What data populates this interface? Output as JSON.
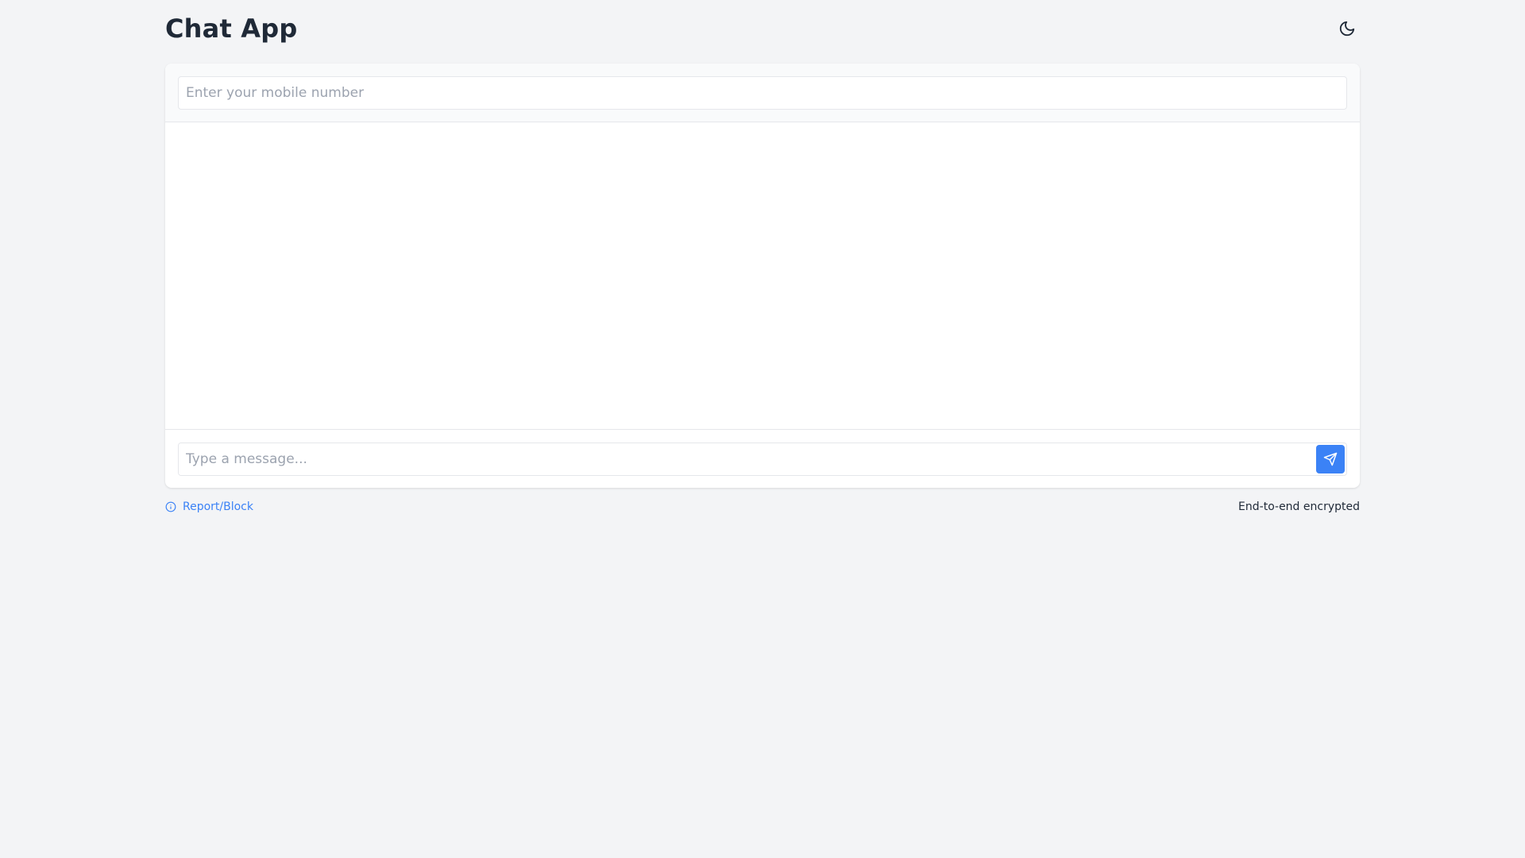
{
  "header": {
    "title": "Chat App",
    "theme_toggle_icon": "moon-icon"
  },
  "contact": {
    "mobile_placeholder": "Enter your mobile number",
    "mobile_value": ""
  },
  "composer": {
    "message_placeholder": "Type a message...",
    "message_value": "",
    "send_icon": "send-icon"
  },
  "footer": {
    "report_label": "Report/Block",
    "report_icon": "info-icon",
    "encryption_label": "End-to-end encrypted"
  },
  "colors": {
    "accent": "#3b82f6",
    "background": "#f3f4f6",
    "card": "#ffffff",
    "title": "#1f2937"
  }
}
